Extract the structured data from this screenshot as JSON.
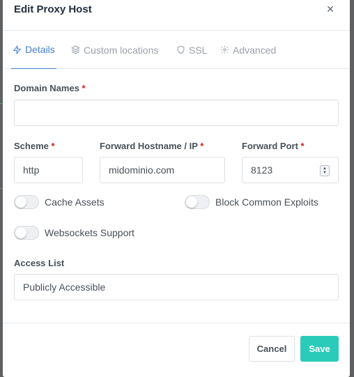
{
  "dialog": {
    "title": "Edit Proxy Host",
    "close_symbol": "×"
  },
  "tabs": [
    {
      "label": "Details",
      "icon": "zap-icon",
      "active": true
    },
    {
      "label": "Custom locations",
      "icon": "layers-icon",
      "active": false
    },
    {
      "label": "SSL",
      "icon": "shield-icon",
      "active": false
    },
    {
      "label": "Advanced",
      "icon": "gear-icon",
      "active": false
    }
  ],
  "form": {
    "domain_names": {
      "label": "Domain Names",
      "required": "*",
      "value": ""
    },
    "scheme": {
      "label": "Scheme",
      "required": "*",
      "value": "http"
    },
    "forward_host": {
      "label": "Forward Hostname / IP",
      "required": "*",
      "value": "midominio.com"
    },
    "forward_port": {
      "label": "Forward Port",
      "required": "*",
      "value": "8123"
    },
    "toggles": [
      {
        "label": "Cache Assets",
        "on": false
      },
      {
        "label": "Block Common Exploits",
        "on": false
      },
      {
        "label": "Websockets Support",
        "on": false
      }
    ],
    "access_list": {
      "label": "Access List",
      "value": "Publicly Accessible"
    }
  },
  "footer": {
    "cancel_label": "Cancel",
    "save_label": "Save"
  },
  "colors": {
    "accent": "#467fcf",
    "save": "#2bcbba",
    "required": "#cd201f"
  }
}
